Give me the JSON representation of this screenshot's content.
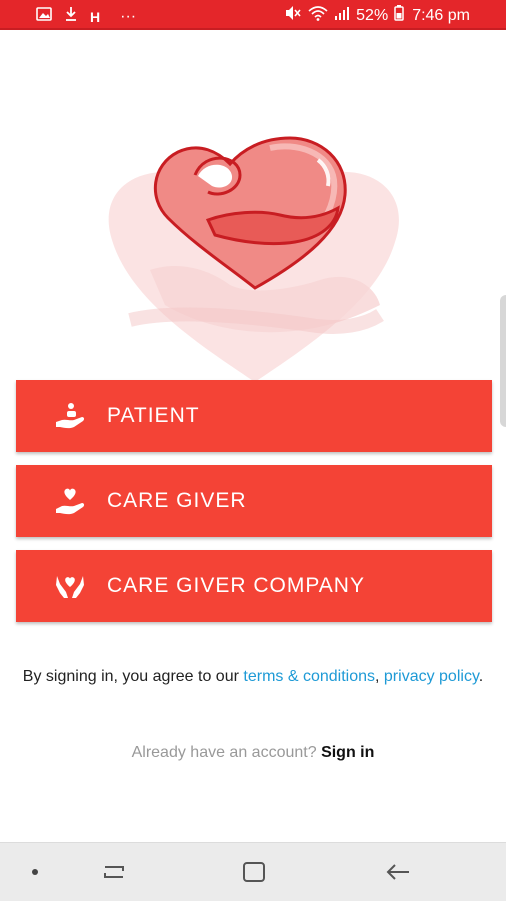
{
  "status_bar": {
    "battery_percent": "52%",
    "time": "7:46 pm",
    "h_indicator": "H",
    "more_dots": "···",
    "left_icons": [
      "image-icon",
      "download-icon"
    ],
    "right_icons": [
      "mute-icon",
      "wifi-icon",
      "signal-icon",
      "battery-icon"
    ]
  },
  "roles": [
    {
      "label": "PATIENT",
      "icon": "hand-with-pill-icon"
    },
    {
      "label": "CARE GIVER",
      "icon": "hand-with-heart-icon"
    },
    {
      "label": "CARE GIVER COMPANY",
      "icon": "hands-holding-heart-icon"
    }
  ],
  "terms": {
    "prefix": "By signing in, you agree to our",
    "terms_link": "terms & conditions",
    "separator": ",",
    "privacy_link": "privacy policy",
    "suffix": "."
  },
  "signin": {
    "prompt": "Already have an account?",
    "link": "Sign in"
  },
  "colors": {
    "status_bar": "#e4262a",
    "button": "#f44336",
    "link": "#1e9ad6"
  },
  "nav_bar": {
    "items": [
      "dot-icon",
      "recent-apps-icon",
      "home-icon",
      "back-icon"
    ]
  }
}
